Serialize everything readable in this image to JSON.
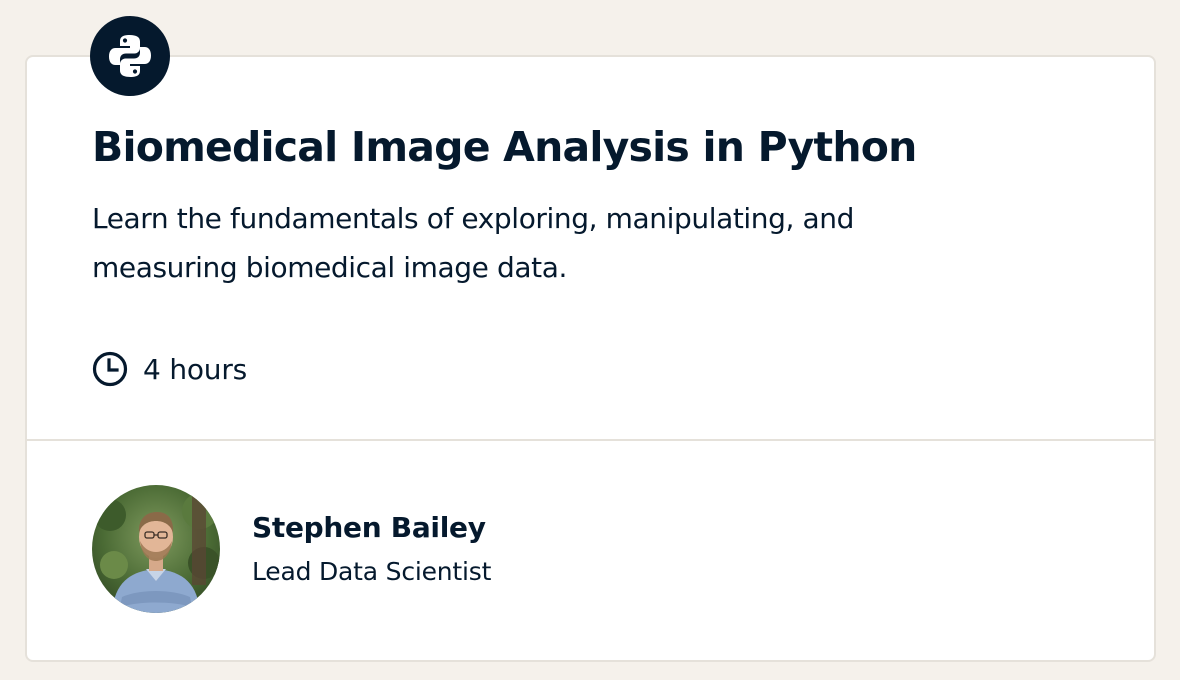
{
  "course": {
    "technology_icon": "python-logo-icon",
    "title": "Biomedical Image Analysis in Python",
    "description": "Learn the fundamentals of exploring, manipulating, and measuring biomedical image data.",
    "duration_icon": "clock-icon",
    "duration": "4 hours"
  },
  "instructor": {
    "avatar": "instructor-photo",
    "name": "Stephen Bailey",
    "role": "Lead Data Scientist"
  },
  "colors": {
    "page_background": "#f5f1eb",
    "card_background": "#ffffff",
    "text_primary": "#05192d",
    "border": "#e5e1da"
  }
}
